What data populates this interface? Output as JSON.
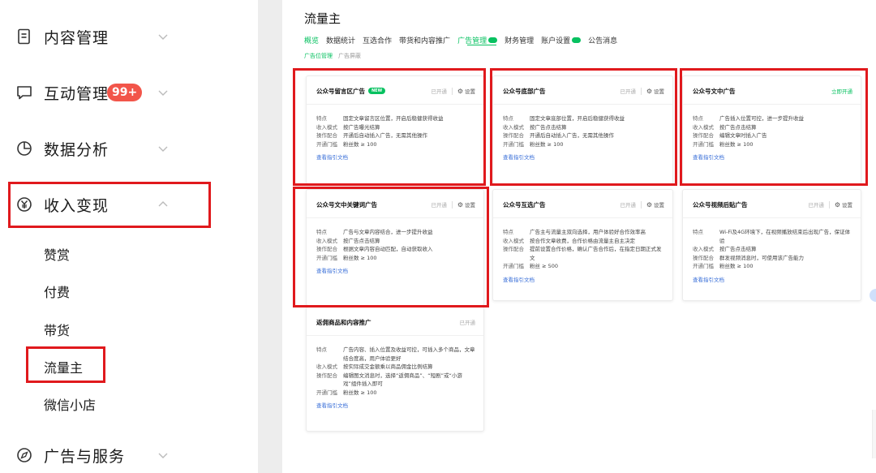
{
  "sidebar": {
    "items": [
      {
        "label": "内容管理",
        "icon": "document-icon"
      },
      {
        "label": "互动管理",
        "icon": "comment-icon",
        "badge": "99+"
      },
      {
        "label": "数据分析",
        "icon": "pie-chart-icon"
      },
      {
        "label": "收入变现",
        "icon": "yen-icon"
      },
      {
        "label": "广告与服务",
        "icon": "compass-icon"
      }
    ],
    "sub_items": [
      "赞赏",
      "付费",
      "带货",
      "流量主",
      "微信小店"
    ]
  },
  "main": {
    "title": "流量主",
    "tabs": [
      "概览",
      "数据统计",
      "互选合作",
      "带货和内容推广",
      "广告管理",
      "财务管理",
      "账户设置",
      "公告消息"
    ],
    "subtabs": [
      "广告位管理",
      "广告屏蔽"
    ],
    "labels": {
      "feature": "特点",
      "income": "收入模式",
      "operation": "操作配合",
      "threshold": "开通门槛",
      "doc_link": "查看指引文档",
      "opened": "已开通",
      "settings": "设置",
      "open_now": "立即开通",
      "new_tag": "NEW"
    },
    "cards": [
      {
        "title": "公众号留言区广告",
        "status": "已开通",
        "feature": "固定文章留言区位置，开启后稳健获得收益",
        "income": "按广告曝光结算",
        "operation": "开通后自动插入广告，无需其他操作",
        "threshold": "粉丝数 ≥ 100"
      },
      {
        "title": "公众号底部广告",
        "status": "已开通",
        "feature": "固定文章底部位置，开启后稳健获得收益",
        "income": "按广告点击结算",
        "operation": "开通后自动插入广告，无需其他操作",
        "threshold": "粉丝数 ≥ 100"
      },
      {
        "title": "公众号文中广告",
        "status": "立即开通",
        "feature": "广告插入位置可控，进一步提升收益",
        "income": "按广告点击结算",
        "operation": "编辑文章时插入广告",
        "threshold": "粉丝数 ≥ 100"
      },
      {
        "title": "公众号文中关键词广告",
        "status": "已开通",
        "feature": "广告与文章内容结合，进一步提升收益",
        "income": "按广告点击结算",
        "operation": "根据文章内容自动匹配，自动获取收入",
        "threshold": "粉丝数 ≥ 100"
      },
      {
        "title": "公众号互选广告",
        "status": "已开通",
        "feature": "广告主与流量主双向选择，用户体验好合作效率高",
        "income": "按合作文章收费，合作价格由流量主自主决定",
        "operation": "提前设置合作价格，确认广告合作后，在指定日期正式发文",
        "threshold": "粉丝 ≥ 500"
      },
      {
        "title": "公众号视频后贴广告",
        "status": "已开通",
        "feature": "Wi-Fi及4G环境下，在视频播放结束后出现广告，保证体验",
        "income": "按广告点击结算",
        "operation": "群发视频消息时，可使用该广告能力",
        "threshold": "粉丝数 ≥ 100"
      },
      {
        "title": "返佣商品和内容推广",
        "status": "已开通",
        "feature": "广告内容、插入位置及收益可控，可插入多个商品，文章结合度高，用户体验更好",
        "income": "按实际成交金额乘以商品佣金比例结算",
        "operation": "编辑图文消息时，选择“返佣商品”、“短剧”或“小游戏”组件插入即可",
        "threshold": "粉丝数 ≥ 100"
      }
    ]
  },
  "colors": {
    "accent": "#07c160",
    "badge": "#f2554a",
    "highlight": "#e0191d",
    "link": "#3a6fd8"
  }
}
